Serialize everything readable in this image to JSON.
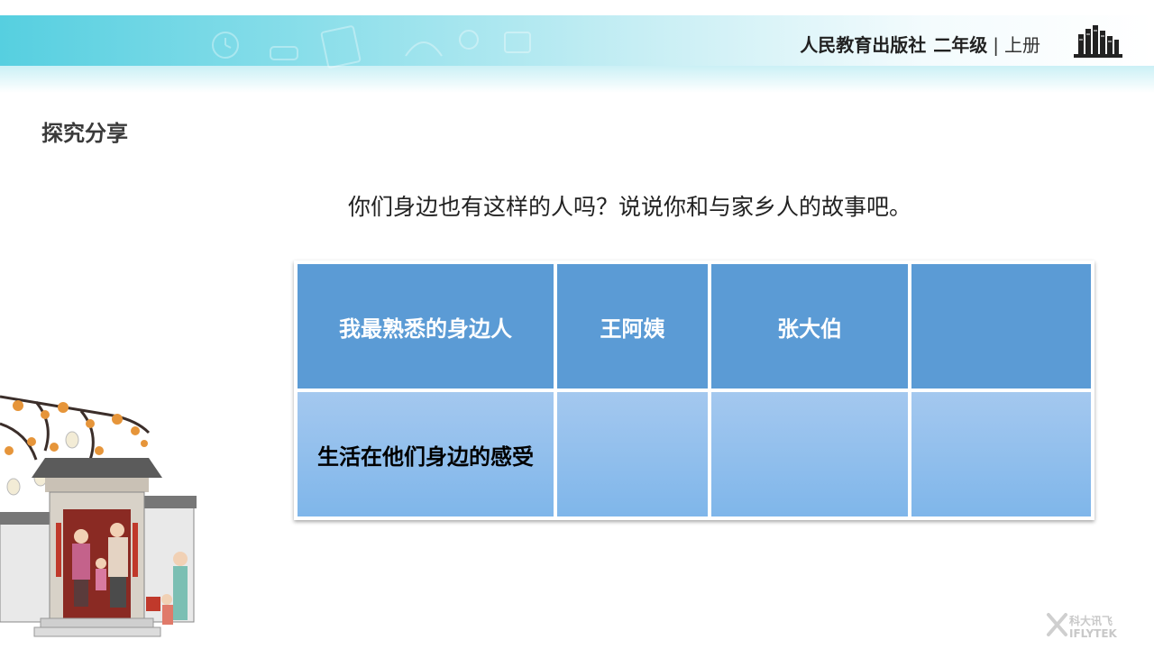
{
  "header": {
    "publisher": "人民教育出版社",
    "grade": "二年级",
    "separator": "|",
    "volume": "上册"
  },
  "section_title": "探究分享",
  "question": "你们身边也有这样的人吗？说说你和与家乡人的故事吧。",
  "table": {
    "header_row": [
      "我最熟悉的身边人",
      "王阿姨",
      "张大伯",
      ""
    ],
    "body_row": [
      "生活在他们身边的感受",
      "",
      "",
      ""
    ]
  },
  "watermark": {
    "cn": "科大讯飞",
    "en": "IFLYTEK"
  },
  "icons": [
    "books-icon",
    "iflytek-logo-icon"
  ],
  "colors": {
    "header_cell": "#5b9bd5",
    "body_cell": "#8fbfee",
    "banner": "#5fd4e4"
  }
}
